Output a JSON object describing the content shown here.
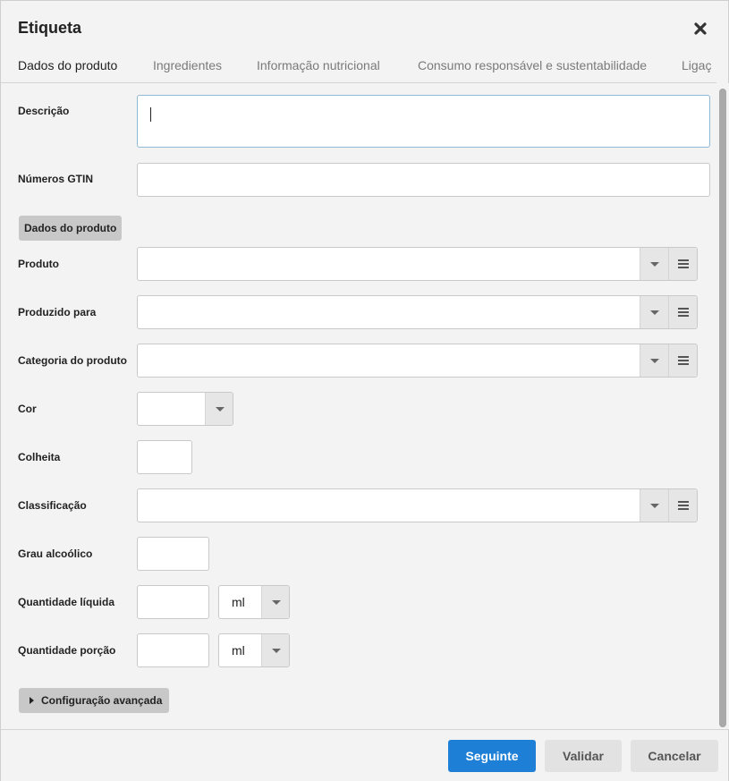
{
  "dialog": {
    "title": "Etiqueta",
    "close_icon": "close-icon"
  },
  "tabs": [
    {
      "label": "Dados do produto",
      "active": true
    },
    {
      "label": "Ingredientes",
      "active": false
    },
    {
      "label": "Informação nutricional",
      "active": false
    },
    {
      "label": "Consumo responsável e sustentabilidade",
      "active": false
    },
    {
      "label": "Ligaç",
      "active": false
    }
  ],
  "form": {
    "descricao": {
      "label": "Descrição",
      "value": ""
    },
    "gtin": {
      "label": "Números GTIN",
      "value": ""
    },
    "section_label": "Dados do produto",
    "produto": {
      "label": "Produto",
      "value": ""
    },
    "produzido_para": {
      "label": "Produzido para",
      "value": ""
    },
    "categoria": {
      "label": "Categoria do produto",
      "value": ""
    },
    "cor": {
      "label": "Cor",
      "value": ""
    },
    "colheita": {
      "label": "Colheita",
      "value": ""
    },
    "classificacao": {
      "label": "Classificação",
      "value": ""
    },
    "grau_alcoolico": {
      "label": "Grau alcoólico",
      "value": ""
    },
    "quantidade_liquida": {
      "label": "Quantidade líquida",
      "value": "",
      "unit": "ml"
    },
    "quantidade_porcao": {
      "label": "Quantidade porção",
      "value": "",
      "unit": "ml"
    },
    "advanced_label": "Configuração avançada"
  },
  "footer": {
    "next_label": "Seguinte",
    "validate_label": "Validar",
    "cancel_label": "Cancelar"
  },
  "colors": {
    "primary": "#1d7fd6",
    "background": "#f3f3f3"
  }
}
